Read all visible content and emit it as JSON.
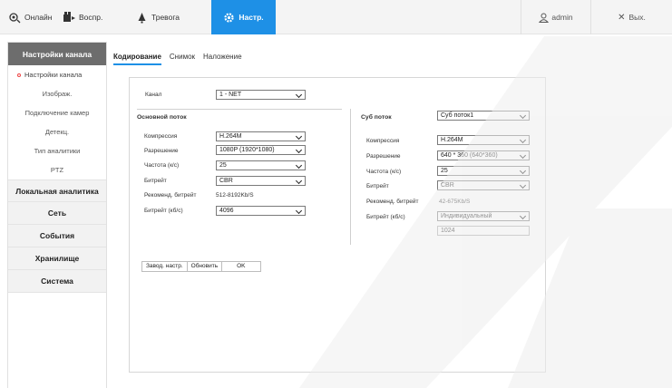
{
  "nav": {
    "online": "Онлайн",
    "playback": "Воспр.",
    "alarm": "Тревога",
    "settings": "Настр.",
    "user": "admin",
    "exit": "Вых."
  },
  "colors": {
    "accent": "#1e90e6",
    "sidebar_header": "#6d6d6d"
  },
  "sidebar": {
    "header": "Настройки канала",
    "sub": [
      "Настройки канала",
      "Изображ.",
      "Подключение камер",
      "Детекц.",
      "Тип аналитики",
      "PTZ"
    ],
    "sections": [
      "Локальная аналитика",
      "Сеть",
      "События",
      "Хранилище",
      "Система"
    ]
  },
  "tabs": [
    "Кодирование",
    "Снимок",
    "Наложение"
  ],
  "main": {
    "channel_label": "Канал",
    "channel_value": "1 - NET",
    "main_stream": {
      "title": "Основной поток",
      "labels": [
        "Компрессия",
        "Разрешение",
        "Частота (к/с)",
        "Битрейт",
        "Рекоменд. битрейт",
        "Битрейт (кб/с)"
      ],
      "compression": "H.264M",
      "resolution": "1080P (1920*1080)",
      "fps": "25",
      "bitrate_type": "CBR",
      "recommended": "512-8192Kb/S",
      "bitrate": "4096"
    },
    "sub_stream": {
      "title": "Суб поток",
      "select": "Суб поток1",
      "labels": [
        "Компрессия",
        "Разрешение",
        "Частота (к/с)",
        "Битрейт",
        "Рекоменд. битрейт",
        "Битрейт (кб/с)"
      ],
      "compression": "H.264M",
      "resolution": "640 * 360 (640*360)",
      "fps": "25",
      "bitrate_type": "CBR",
      "recommended": "42-675Kb/S",
      "bitrate_mode": "Индивидуальный",
      "bitrate": "1024"
    },
    "buttons": {
      "defaults": "Завод. настр.",
      "refresh": "Обновить",
      "ok": "OK"
    }
  }
}
